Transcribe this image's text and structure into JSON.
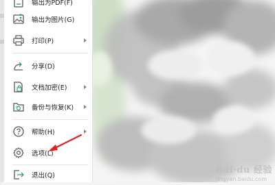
{
  "menu": {
    "items": [
      {
        "id": "output-pdf",
        "label": "输出为PDF(F)",
        "icon": "pdf-icon",
        "has_submenu": false
      },
      {
        "id": "output-image",
        "label": "输出为图片(G)",
        "icon": "image-icon",
        "has_submenu": false
      },
      {
        "id": "print",
        "label": "打印(P)",
        "icon": "printer-icon",
        "has_submenu": true
      },
      {
        "id": "share",
        "label": "分享(D)",
        "icon": "share-icon",
        "has_submenu": false
      },
      {
        "id": "encrypt",
        "label": "文档加密(E)",
        "icon": "lock-document-icon",
        "has_submenu": true
      },
      {
        "id": "backup",
        "label": "备份与恢复(K)",
        "icon": "backup-icon",
        "has_submenu": true
      },
      {
        "id": "help",
        "label": "帮助(H)",
        "icon": "help-icon",
        "has_submenu": true
      },
      {
        "id": "options",
        "label": "选项(L)",
        "icon": "gear-icon",
        "has_submenu": false
      },
      {
        "id": "exit",
        "label": "退出(Q)",
        "icon": "exit-icon",
        "has_submenu": false
      }
    ]
  },
  "watermark": {
    "text": "Bai·du 经验",
    "sub": "jingyan.baidu.com"
  },
  "colors": {
    "annotation_arrow": "#e0201f",
    "icon_stroke": "#555555",
    "icon_accent": "#2f9e73"
  }
}
